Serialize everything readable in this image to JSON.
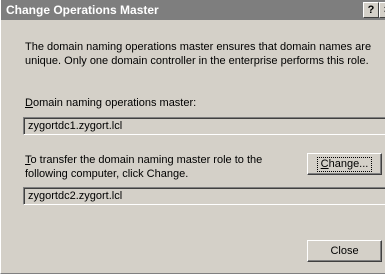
{
  "window": {
    "title": "Change Operations Master",
    "help_glyph": "?",
    "close_glyph": "×"
  },
  "description": "The domain naming operations master ensures that domain names are unique. Only one domain controller in the enterprise performs this role.",
  "current_master": {
    "label_mnemonic": "D",
    "label_rest": "omain naming operations master:",
    "value": "zygortdc1.zygort.lcl"
  },
  "transfer": {
    "label_mnemonic": "T",
    "label_line1_rest": "o transfer the domain naming master role to the",
    "label_line2": "following computer, click Change.",
    "value": "zygortdc2.zygort.lcl"
  },
  "buttons": {
    "change_mnemonic": "C",
    "change_rest": "hange...",
    "close": "Close"
  }
}
